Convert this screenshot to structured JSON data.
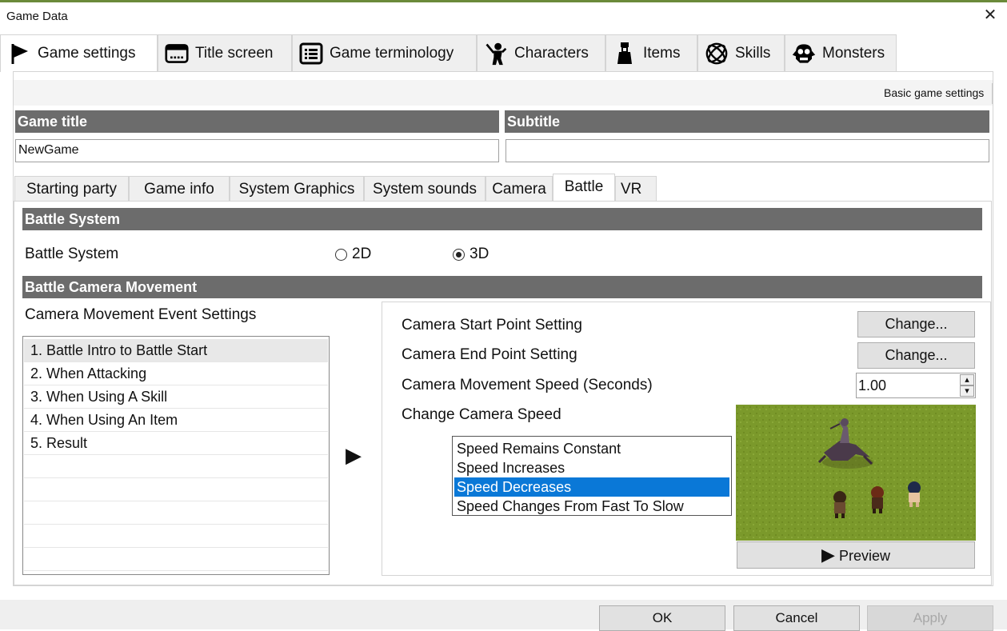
{
  "window": {
    "title": "Game Data",
    "close_glyph": "✕"
  },
  "main_tabs": [
    {
      "label": "Game settings",
      "icon": "flag-icon",
      "active": true
    },
    {
      "label": "Title screen",
      "icon": "title-screen-icon",
      "active": false
    },
    {
      "label": "Game terminology",
      "icon": "list-icon",
      "active": false
    },
    {
      "label": "Characters",
      "icon": "characters-icon",
      "active": false
    },
    {
      "label": "Items",
      "icon": "items-icon",
      "active": false
    },
    {
      "label": "Skills",
      "icon": "skills-icon",
      "active": false
    },
    {
      "label": "Monsters",
      "icon": "monsters-icon",
      "active": false
    }
  ],
  "basic_settings_label": "Basic game settings",
  "game_title": {
    "header": "Game title",
    "value": "NewGame"
  },
  "subtitle": {
    "header": "Subtitle",
    "value": ""
  },
  "sub_tabs": [
    {
      "label": "Starting party",
      "active": false
    },
    {
      "label": "Game info",
      "active": false
    },
    {
      "label": "System Graphics",
      "active": false
    },
    {
      "label": "System sounds",
      "active": false
    },
    {
      "label": "Camera",
      "active": false
    },
    {
      "label": "Battle",
      "active": true
    },
    {
      "label": "VR",
      "active": false
    }
  ],
  "battle_system": {
    "header": "Battle System",
    "label": "Battle System",
    "option_2d": "2D",
    "option_3d": "3D",
    "selected": "3D"
  },
  "camera_movement": {
    "header": "Battle Camera Movement",
    "events_label": "Camera Movement Event Settings",
    "events": [
      "1. Battle Intro to Battle Start",
      "2. When Attacking",
      "3. When Using A Skill",
      "4. When Using An Item",
      "5. Result"
    ],
    "selected_event_index": 0,
    "arrow_glyph": "▶",
    "start_point_label": "Camera Start Point Setting",
    "end_point_label": "Camera End Point Setting",
    "change_label": "Change...",
    "speed_label": "Camera Movement Speed (Seconds)",
    "speed_value": "1.00",
    "spin_up_glyph": "▴",
    "spin_down_glyph": "▾",
    "change_speed_label": "Change Camera Speed",
    "speed_options": [
      "Speed Remains Constant",
      "Speed Increases",
      "Speed Decreases",
      "Speed Changes From Fast To Slow"
    ],
    "selected_speed_index": 2,
    "preview_label": "Preview",
    "preview_glyph": "▶"
  },
  "footer": {
    "ok": "OK",
    "cancel": "Cancel",
    "apply": "Apply"
  },
  "colors": {
    "section_header": "#6c6c6c",
    "selection_blue": "#0a78d7",
    "preview_grass": "#7d9a2a"
  }
}
